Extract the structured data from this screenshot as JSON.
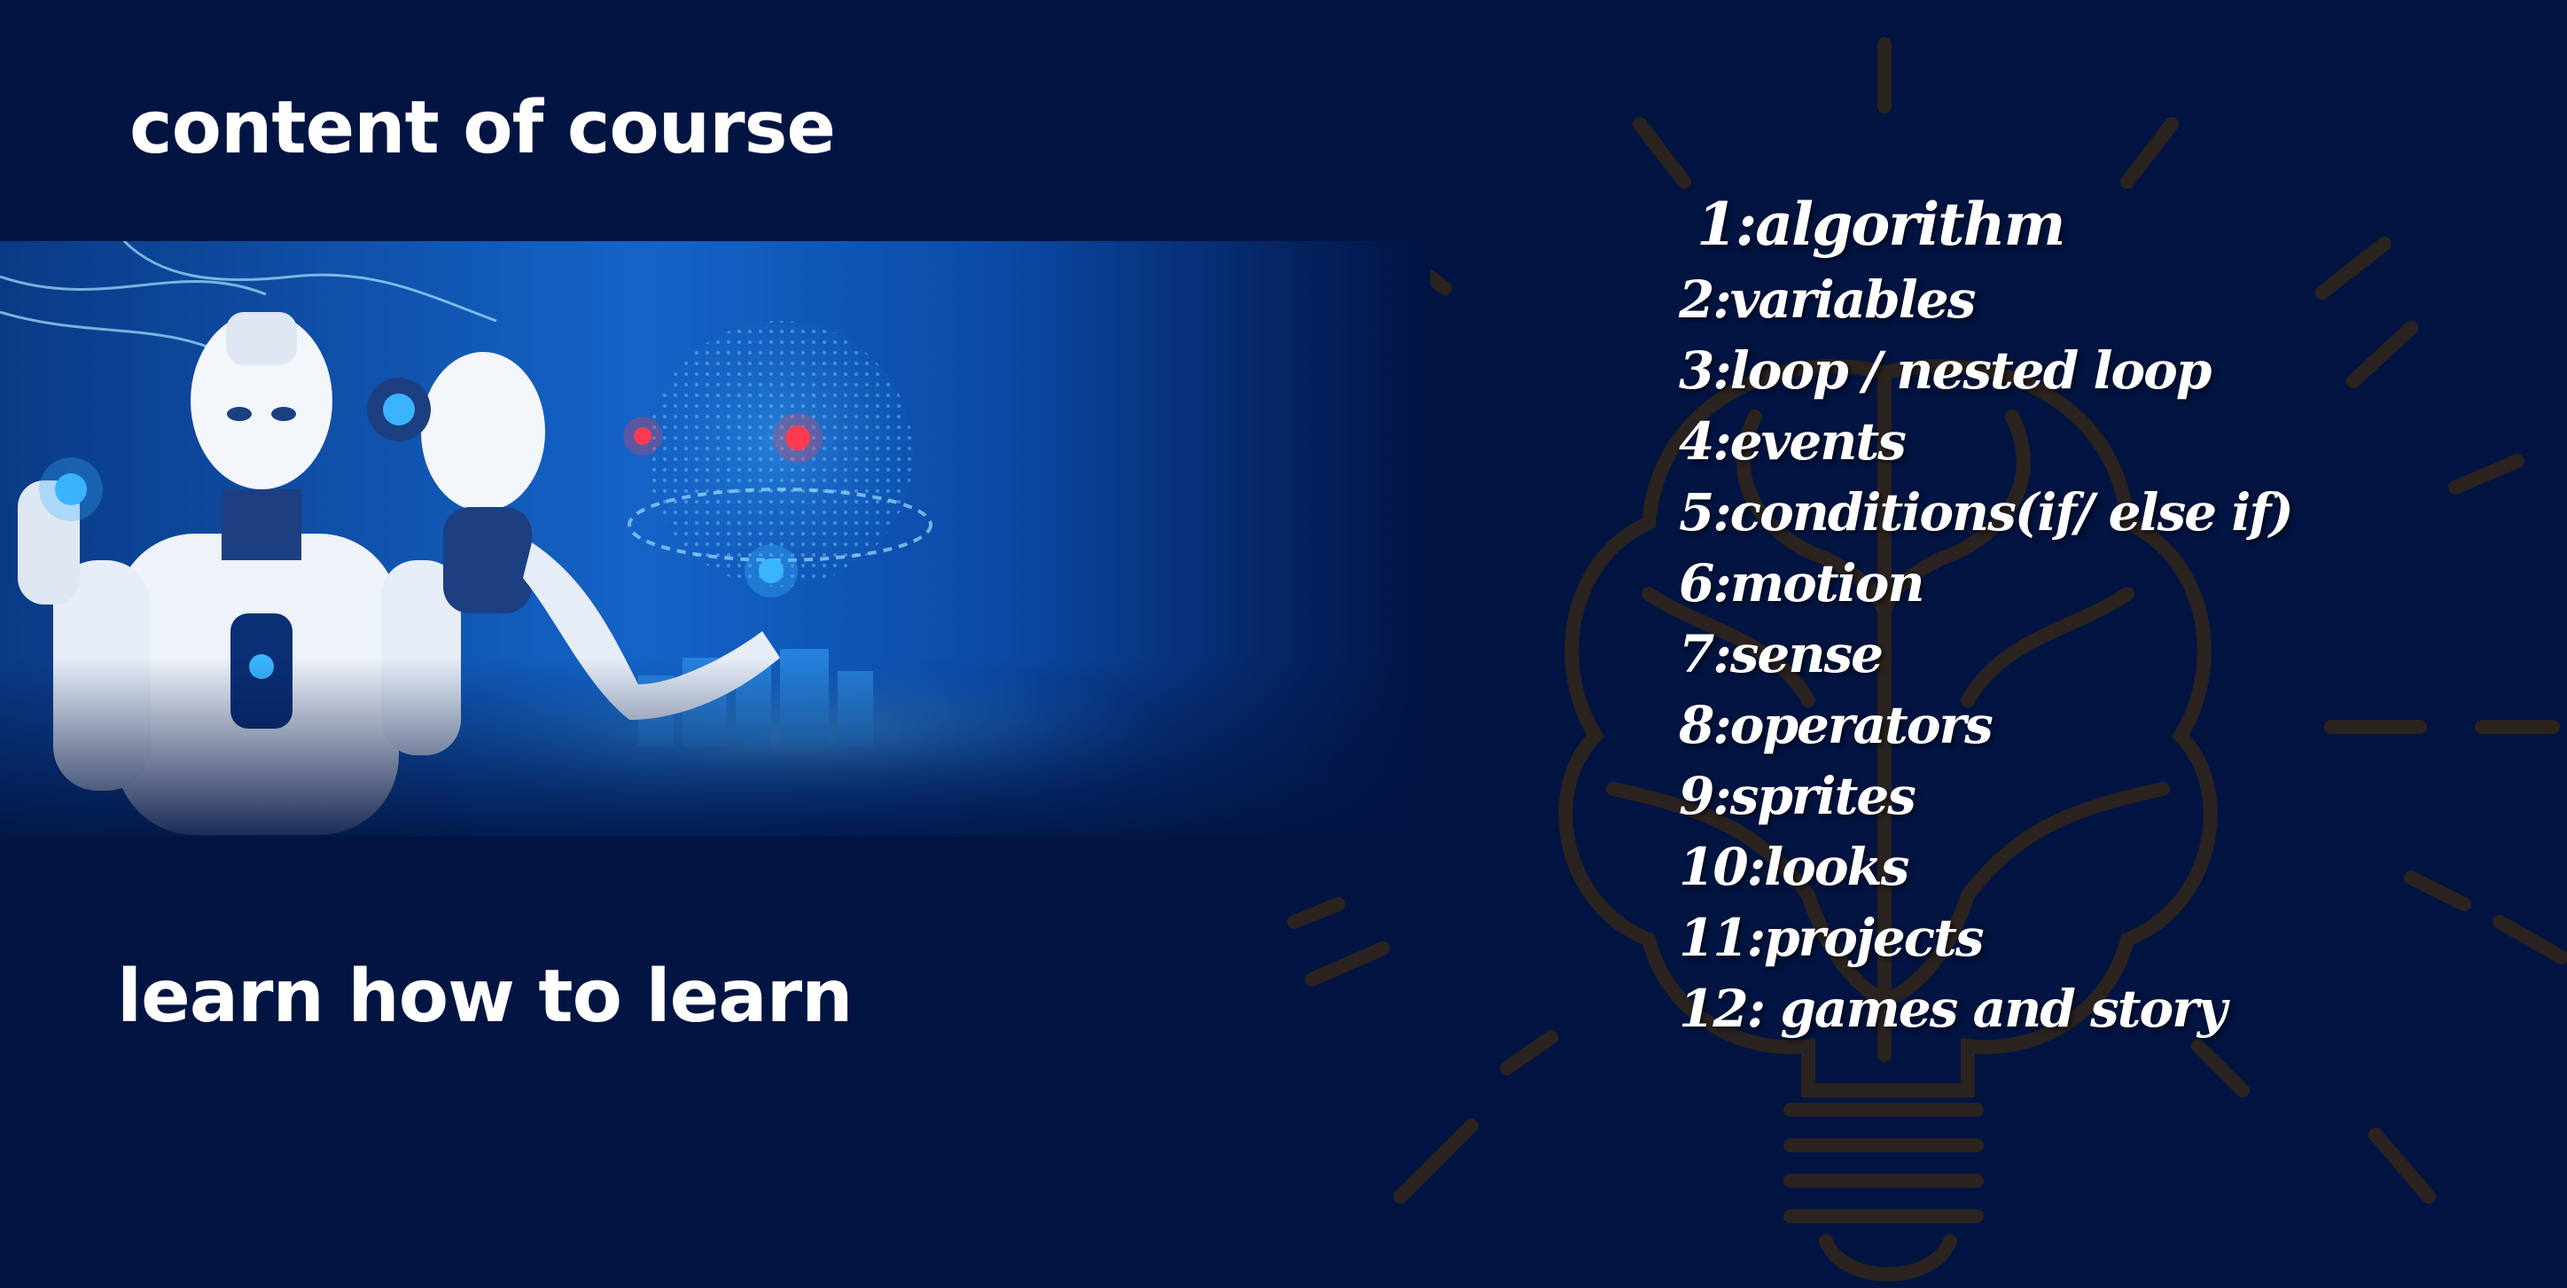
{
  "title": "content of course",
  "tagline": "learn how to learn",
  "topics": [
    "1:algorithm",
    "2:variables",
    "3:loop / nested loop",
    "4:events",
    "5:conditions(if/ else if)",
    "6:motion",
    "7:sense",
    "8:operators",
    "9:sprites",
    "10:looks",
    "11:projects",
    "12: games and story"
  ],
  "icons": {
    "hero": "robots-illustration",
    "background": "lightbulb-brain-icon"
  },
  "colors": {
    "background": "#021442",
    "text": "#ffffff",
    "bulb_outline": "#2b231f",
    "hero_glow": "#1e7fe0"
  }
}
